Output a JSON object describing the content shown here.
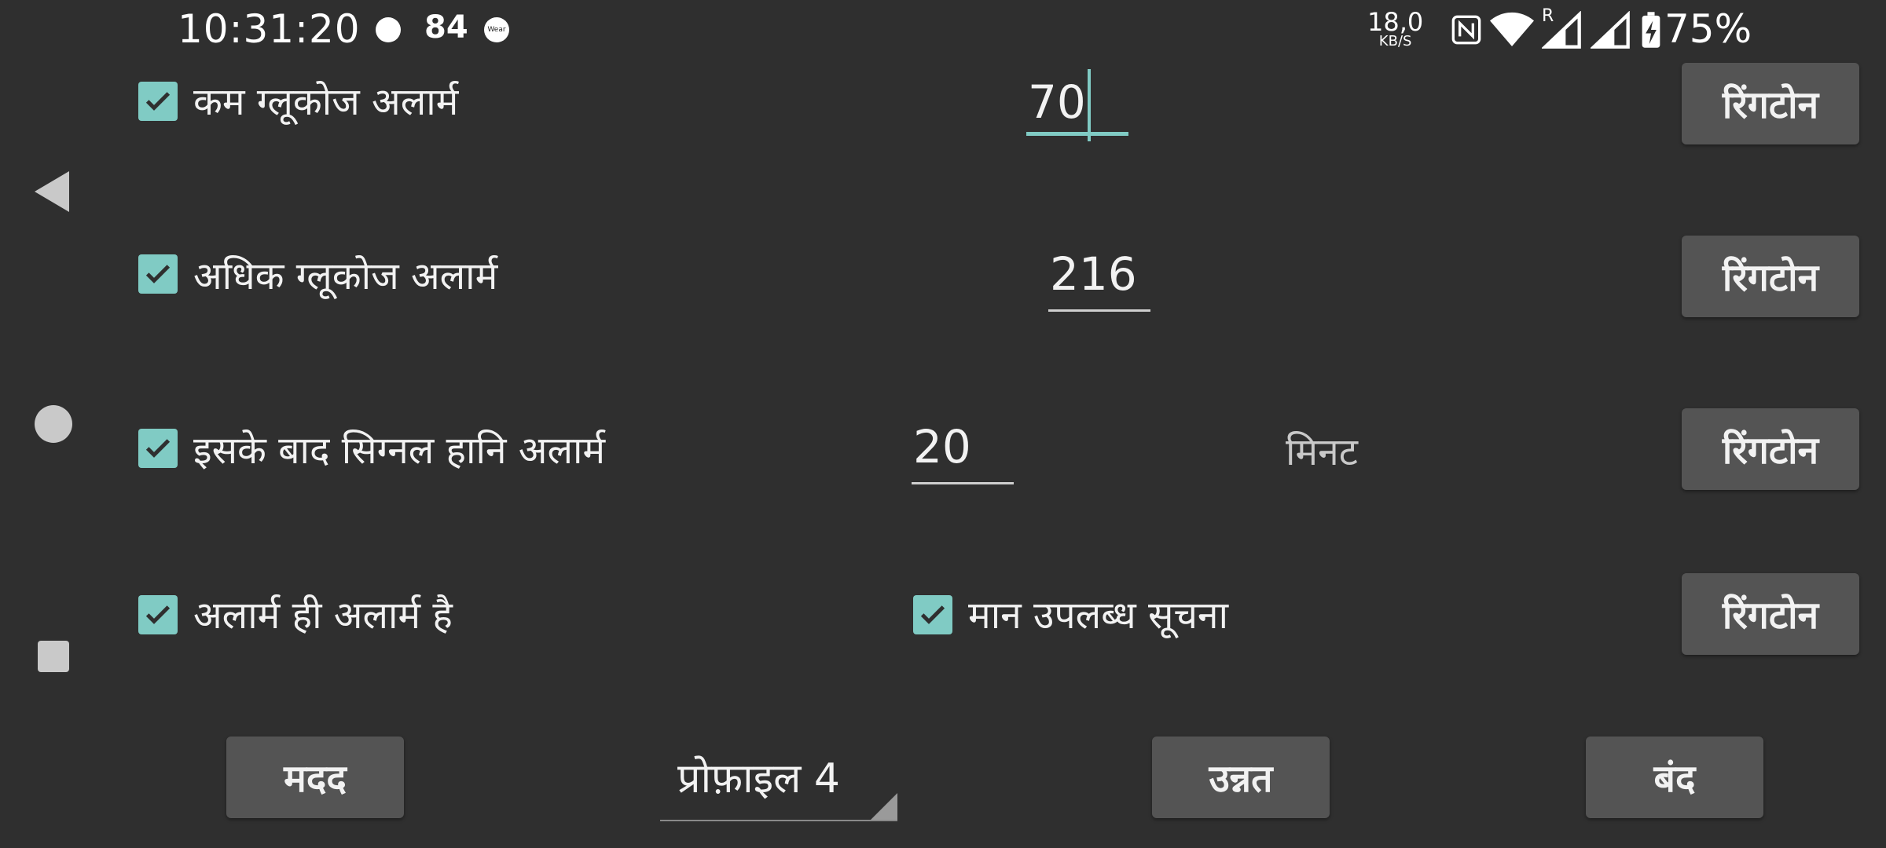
{
  "status_bar": {
    "time": "10:31:20",
    "notif_count": "84",
    "wear_label": "Wear",
    "speed_value": "18,0",
    "speed_unit": "KB/S",
    "roaming": "R",
    "battery_pct": "75%",
    "icons": [
      "nfc-icon",
      "wifi-icon",
      "signal-icon",
      "signal-icon",
      "battery-charging-icon"
    ]
  },
  "nav": {
    "back": "back-icon",
    "home": "home-icon",
    "recents": "recents-icon"
  },
  "rows": {
    "low": {
      "label": "कम ग्लूकोज अलार्म",
      "value": "70",
      "ringtone": "रिंगटोन",
      "checked": true
    },
    "high": {
      "label": "अधिक ग्लूकोज अलार्म",
      "value": "216",
      "ringtone": "रिंगटोन",
      "checked": true
    },
    "signal": {
      "label": "इसके बाद सिग्नल हानि अलार्म",
      "value": "20",
      "unit": "मिनट",
      "ringtone": "रिंगटोन",
      "checked": true
    },
    "alarm": {
      "label": "अलार्म ही अलार्म है",
      "checked": true
    },
    "value_notice": {
      "label": "मान उपलब्ध सूचना",
      "ringtone": "रिंगटोन",
      "checked": true
    }
  },
  "footer": {
    "help": "मदद",
    "profile": "प्रोफ़ाइल 4",
    "advanced": "उन्नत",
    "close": "बंद"
  },
  "colors": {
    "accent": "#80cbc4",
    "background": "#2f2f2f",
    "button": "#545454"
  }
}
